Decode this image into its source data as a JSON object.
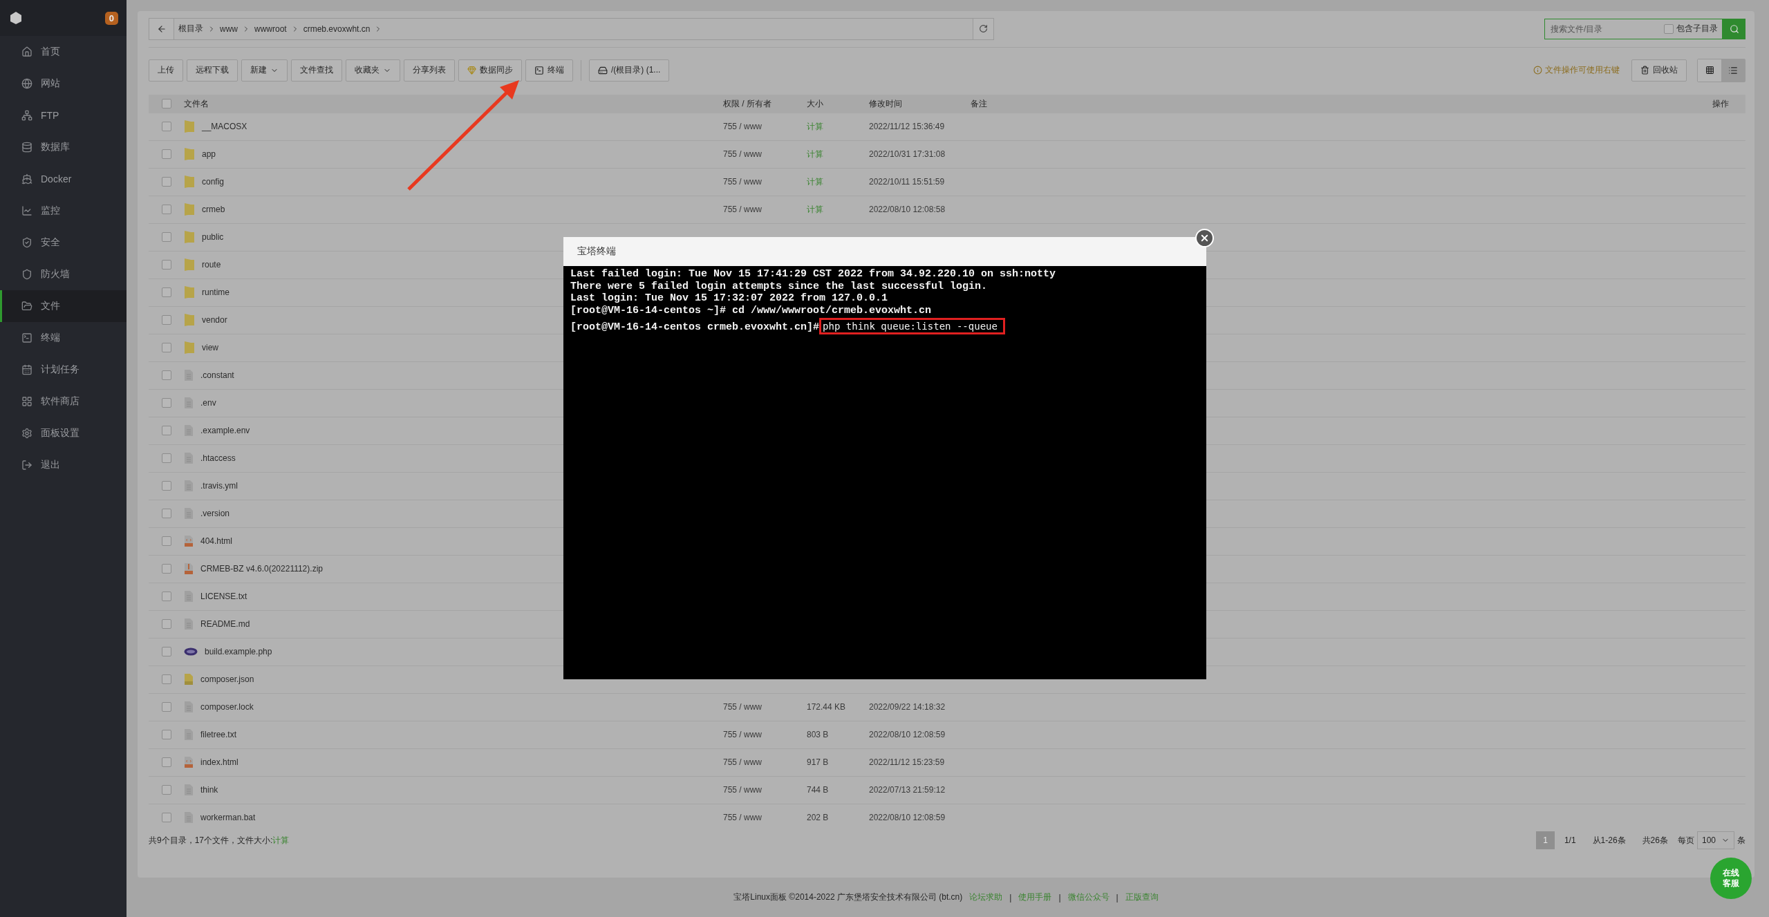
{
  "sidebar": {
    "badge": "0",
    "items": [
      {
        "label": "首页",
        "selected": false
      },
      {
        "label": "网站",
        "selected": false
      },
      {
        "label": "FTP",
        "selected": false
      },
      {
        "label": "数据库",
        "selected": false
      },
      {
        "label": "Docker",
        "selected": false
      },
      {
        "label": "监控",
        "selected": false
      },
      {
        "label": "安全",
        "selected": false
      },
      {
        "label": "防火墙",
        "selected": false
      },
      {
        "label": "文件",
        "selected": true
      },
      {
        "label": "终端",
        "selected": false
      },
      {
        "label": "计划任务",
        "selected": false
      },
      {
        "label": "软件商店",
        "selected": false
      },
      {
        "label": "面板设置",
        "selected": false
      },
      {
        "label": "退出",
        "selected": false
      }
    ]
  },
  "breadcrumb": [
    "根目录",
    "www",
    "wwwroot",
    "crmeb.evoxwht.cn"
  ],
  "search": {
    "placeholder": "搜索文件/目录",
    "include_subdirs": {
      "label": "包含子目录",
      "checked": false
    }
  },
  "toolbar": [
    {
      "label": "上传",
      "kind": "plain"
    },
    {
      "label": "远程下载",
      "kind": "plain"
    },
    {
      "label": "新建",
      "kind": "dropdown"
    },
    {
      "label": "文件查找",
      "kind": "plain"
    },
    {
      "label": "收藏夹",
      "kind": "dropdown"
    },
    {
      "label": "分享列表",
      "kind": "plain"
    },
    {
      "label": "数据同步",
      "kind": "gem"
    },
    {
      "label": "终端",
      "kind": "terminal"
    },
    {
      "label": "/(根目录) (1...",
      "kind": "disk"
    }
  ],
  "tip": "文件操作可使用右键",
  "recycle_bin": "回收站",
  "views": [
    {
      "kind": "grid",
      "selected": false
    },
    {
      "kind": "list",
      "selected": true
    }
  ],
  "table": {
    "columns": [
      "文件名",
      "权限 / 所有者",
      "大小",
      "修改时间",
      "备注",
      "操作"
    ],
    "all_checked": false,
    "rows": [
      {
        "name": "__MACOSX",
        "kind": "folder",
        "checked": false,
        "perm": "755 / www",
        "size": "计算",
        "size_is_action": true,
        "modified": "2022/11/12 15:36:49"
      },
      {
        "name": "app",
        "kind": "folder",
        "checked": false,
        "perm": "755 / www",
        "size": "计算",
        "size_is_action": true,
        "modified": "2022/10/31 17:31:08"
      },
      {
        "name": "config",
        "kind": "folder",
        "checked": false,
        "perm": "755 / www",
        "size": "计算",
        "size_is_action": true,
        "modified": "2022/10/11 15:51:59"
      },
      {
        "name": "crmeb",
        "kind": "folder",
        "checked": false,
        "perm": "755 / www",
        "size": "计算",
        "size_is_action": true,
        "modified": "2022/08/10 12:08:58"
      },
      {
        "name": "public",
        "kind": "folder",
        "checked": false
      },
      {
        "name": "route",
        "kind": "folder",
        "checked": false
      },
      {
        "name": "runtime",
        "kind": "folder",
        "checked": false
      },
      {
        "name": "vendor",
        "kind": "folder",
        "checked": false
      },
      {
        "name": "view",
        "kind": "folder",
        "checked": false
      },
      {
        "name": ".constant",
        "kind": "file",
        "checked": false
      },
      {
        "name": ".env",
        "kind": "file",
        "checked": false
      },
      {
        "name": ".example.env",
        "kind": "file",
        "checked": false
      },
      {
        "name": ".htaccess",
        "kind": "file",
        "checked": false
      },
      {
        "name": ".travis.yml",
        "kind": "file",
        "checked": false
      },
      {
        "name": ".version",
        "kind": "file",
        "checked": false
      },
      {
        "name": "404.html",
        "kind": "html",
        "checked": false
      },
      {
        "name": "CRMEB-BZ v4.6.0(20221112).zip",
        "kind": "zip",
        "checked": false
      },
      {
        "name": "LICENSE.txt",
        "kind": "file",
        "checked": false
      },
      {
        "name": "README.md",
        "kind": "file",
        "checked": false
      },
      {
        "name": "build.example.php",
        "kind": "php",
        "checked": false
      },
      {
        "name": "composer.json",
        "kind": "json",
        "checked": false
      },
      {
        "name": "composer.lock",
        "kind": "file",
        "checked": false,
        "perm": "755 / www",
        "size": "172.44 KB",
        "size_is_action": false,
        "modified": "2022/09/22 14:18:32"
      },
      {
        "name": "filetree.txt",
        "kind": "file",
        "checked": false,
        "perm": "755 / www",
        "size": "803 B",
        "size_is_action": false,
        "modified": "2022/08/10 12:08:59"
      },
      {
        "name": "index.html",
        "kind": "html",
        "checked": false,
        "perm": "755 / www",
        "size": "917 B",
        "size_is_action": false,
        "modified": "2022/11/12 15:23:59"
      },
      {
        "name": "think",
        "kind": "file",
        "checked": false,
        "perm": "755 / www",
        "size": "744 B",
        "size_is_action": false,
        "modified": "2022/07/13 21:59:12"
      },
      {
        "name": "workerman.bat",
        "kind": "file",
        "checked": false,
        "perm": "755 / www",
        "size": "202 B",
        "size_is_action": false,
        "modified": "2022/08/10 12:08:59"
      }
    ]
  },
  "summary": {
    "text": "共9个目录，17个文件，文件大小: ",
    "action": "计算"
  },
  "pagination": {
    "current": "1",
    "pages": "1/1",
    "range": "从1-26条",
    "total": "共26条",
    "per_page_label": "每页",
    "per_page": "100",
    "unit": "条"
  },
  "terminal": {
    "title": "宝塔终端",
    "lines": [
      "Last failed login: Tue Nov 15 17:41:29 CST 2022 from 34.92.220.10 on ssh:notty",
      "There were 5 failed login attempts since the last successful login.",
      "Last login: Tue Nov 15 17:32:07 2022 from 127.0.0.1",
      "[root@VM-16-14-centos ~]# cd /www/wwwroot/crmeb.evoxwht.cn"
    ],
    "prompt": "[root@VM-16-14-centos crmeb.evoxwht.cn]#",
    "command": "php think queue:listen --queue",
    "command_highlighted": true
  },
  "footer": {
    "copyright": "宝塔Linux面板 ©2014-2022 广东堡塔安全技术有限公司 (bt.cn)",
    "links": [
      "论坛求助",
      "使用手册",
      "微信公众号",
      "正版查询"
    ],
    "separator": "|"
  },
  "chat_button": [
    "在线",
    "客服"
  ]
}
